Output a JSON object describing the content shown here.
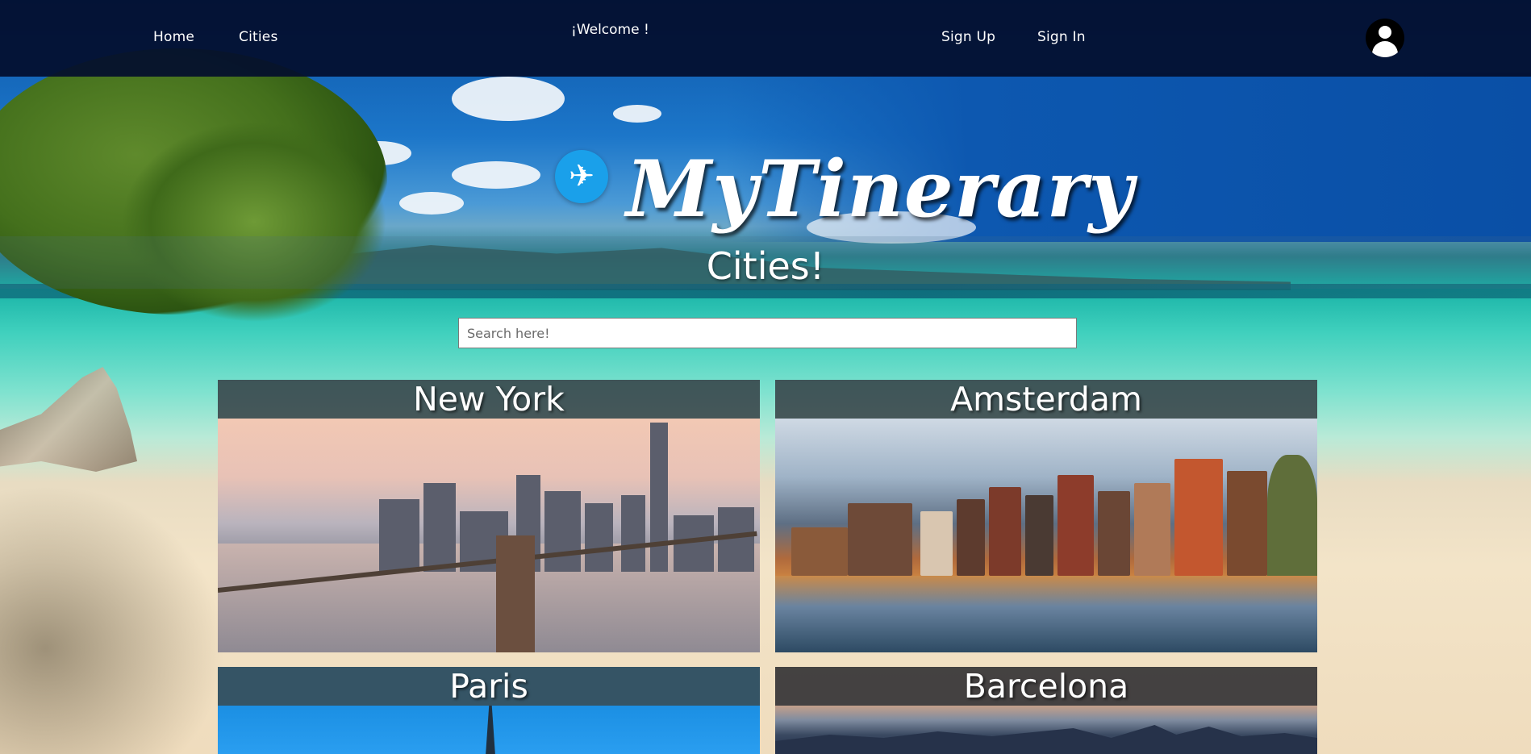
{
  "nav": {
    "home": "Home",
    "cities": "Cities",
    "welcome": "¡Welcome !",
    "signup": "Sign Up",
    "signin": "Sign In"
  },
  "logo": {
    "text": "MyTinerary",
    "icon": "airplane-icon",
    "icon_color": "#1aa0ea"
  },
  "page": {
    "heading": "Cities!"
  },
  "search": {
    "placeholder": "Search here!",
    "value": ""
  },
  "cities": [
    {
      "name": "New York"
    },
    {
      "name": "Amsterdam"
    },
    {
      "name": "Paris"
    },
    {
      "name": "Barcelona"
    }
  ],
  "colors": {
    "navbar": "#030e2d",
    "card_title_bg": "#32373e"
  }
}
